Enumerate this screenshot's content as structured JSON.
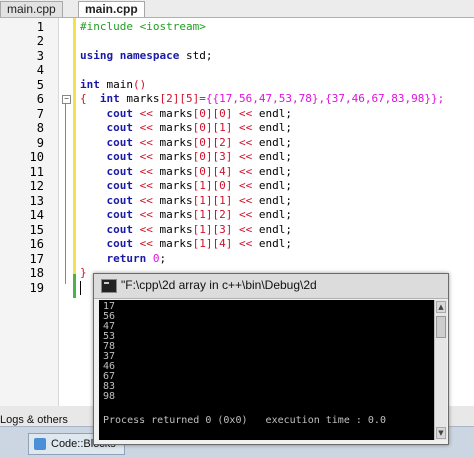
{
  "tabs": [
    {
      "label": "main.cpp"
    },
    {
      "label": "main.cpp"
    }
  ],
  "line_numbers": [
    "1",
    "2",
    "3",
    "4",
    "5",
    "6",
    "7",
    "8",
    "9",
    "10",
    "11",
    "12",
    "13",
    "14",
    "15",
    "16",
    "17",
    "18",
    "19"
  ],
  "code": {
    "l1": "#include <iostream>",
    "l3_kw1": "using",
    "l3_kw2": "namespace",
    "l3_id": "std;",
    "l5_kw": "int",
    "l5_id": "main",
    "l5_br": "()",
    "l6_br": "{",
    "l6_kw": "int",
    "l6_id": "marks",
    "l6_dims": "[2][5]",
    "l6_eq": "=",
    "l6_init": "{{17,56,47,53,78},{37,46,67,83,98}};",
    "cout_lines": [
      {
        "kw": "cout",
        "op1": "<<",
        "arr": "marks",
        "idx": "[0][0]",
        "op2": "<<",
        "end": "endl;"
      },
      {
        "kw": "cout",
        "op1": "<<",
        "arr": "marks",
        "idx": "[0][1]",
        "op2": "<<",
        "end": "endl;"
      },
      {
        "kw": "cout",
        "op1": "<<",
        "arr": "marks",
        "idx": "[0][2]",
        "op2": "<<",
        "end": "endl;"
      },
      {
        "kw": "cout",
        "op1": "<<",
        "arr": "marks",
        "idx": "[0][3]",
        "op2": "<<",
        "end": "endl;"
      },
      {
        "kw": "cout",
        "op1": "<<",
        "arr": "marks",
        "idx": "[0][4]",
        "op2": "<<",
        "end": "endl;"
      },
      {
        "kw": "cout",
        "op1": "<<",
        "arr": "marks",
        "idx": "[1][0]",
        "op2": "<<",
        "end": "endl;"
      },
      {
        "kw": "cout",
        "op1": "<<",
        "arr": "marks",
        "idx": "[1][1]",
        "op2": "<<",
        "end": "endl;"
      },
      {
        "kw": "cout",
        "op1": "<<",
        "arr": "marks",
        "idx": "[1][2]",
        "op2": "<<",
        "end": "endl;"
      },
      {
        "kw": "cout",
        "op1": "<<",
        "arr": "marks",
        "idx": "[1][3]",
        "op2": "<<",
        "end": "endl;"
      },
      {
        "kw": "cout",
        "op1": "<<",
        "arr": "marks",
        "idx": "[1][4]",
        "op2": "<<",
        "end": "endl;"
      }
    ],
    "l17_kw": "return",
    "l17_num": "0",
    "l17_end": ";",
    "l18_br": "}"
  },
  "console": {
    "title": "\"F:\\cpp\\2d array in c++\\bin\\Debug\\2d",
    "output": [
      "17",
      "56",
      "47",
      "53",
      "78",
      "37",
      "46",
      "67",
      "83",
      "98"
    ],
    "status": "Process returned 0 (0x0)   execution time : 0.0"
  },
  "bottom_panel": {
    "logs_label": "Logs & others"
  },
  "taskbar": {
    "item_label": "Code::Blocks"
  },
  "colors": {
    "preprocessor": "#21a021",
    "keyword": "#1a1aa6",
    "operator": "#d0102a",
    "number": "#e010e0"
  }
}
